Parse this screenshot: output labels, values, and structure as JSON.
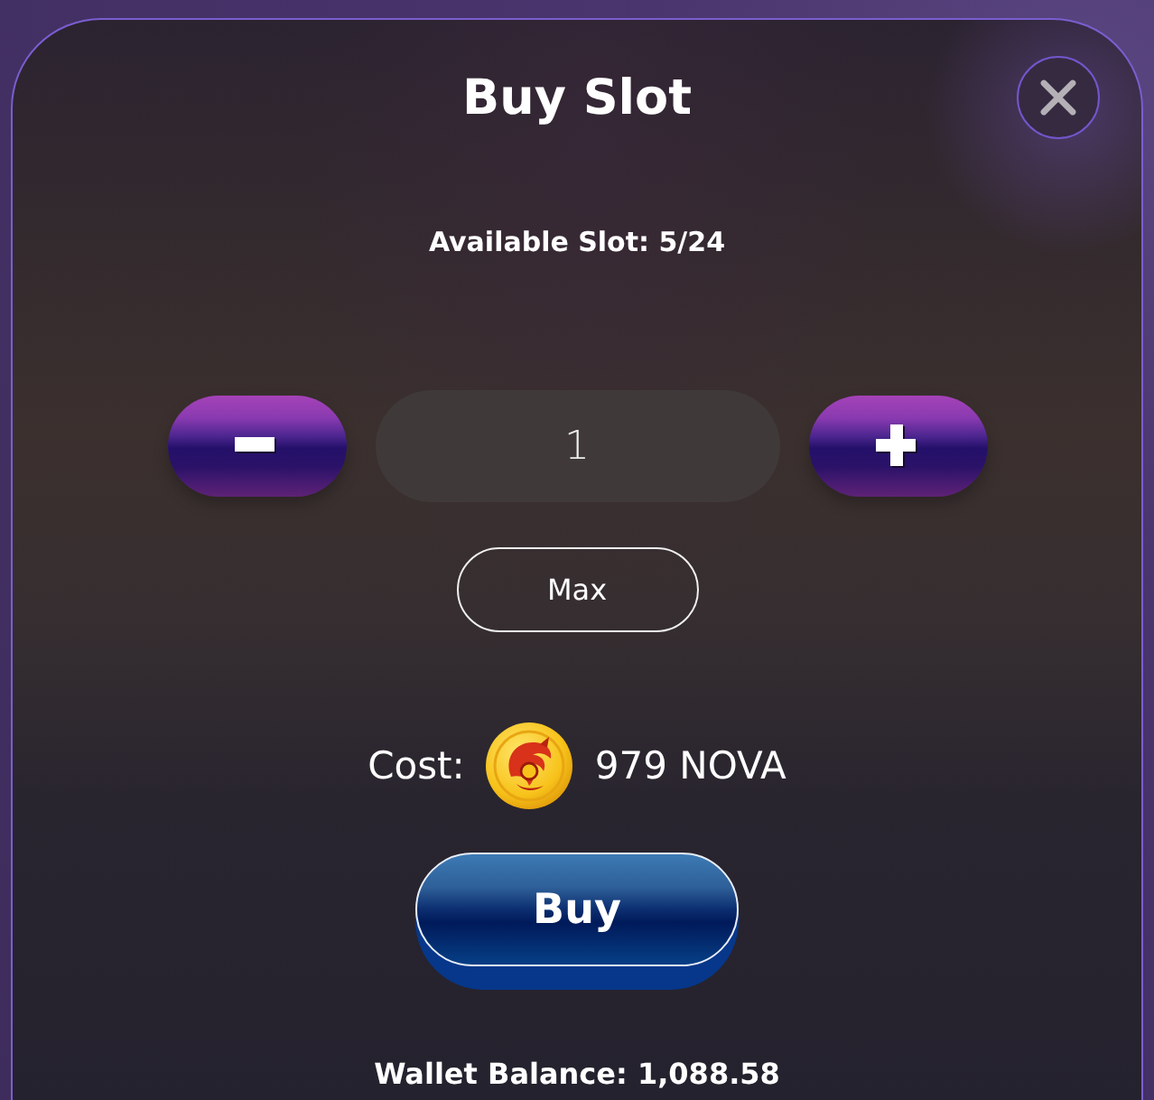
{
  "dialog": {
    "title": "Buy Slot"
  },
  "available_slot": "Available Slot: 5/24",
  "quantity": {
    "value": "1"
  },
  "max_button": "Max",
  "cost": {
    "label": "Cost:",
    "amount": "979 NOVA"
  },
  "buy_button": "Buy",
  "wallet_balance": "Wallet Balance: 1,088.58"
}
